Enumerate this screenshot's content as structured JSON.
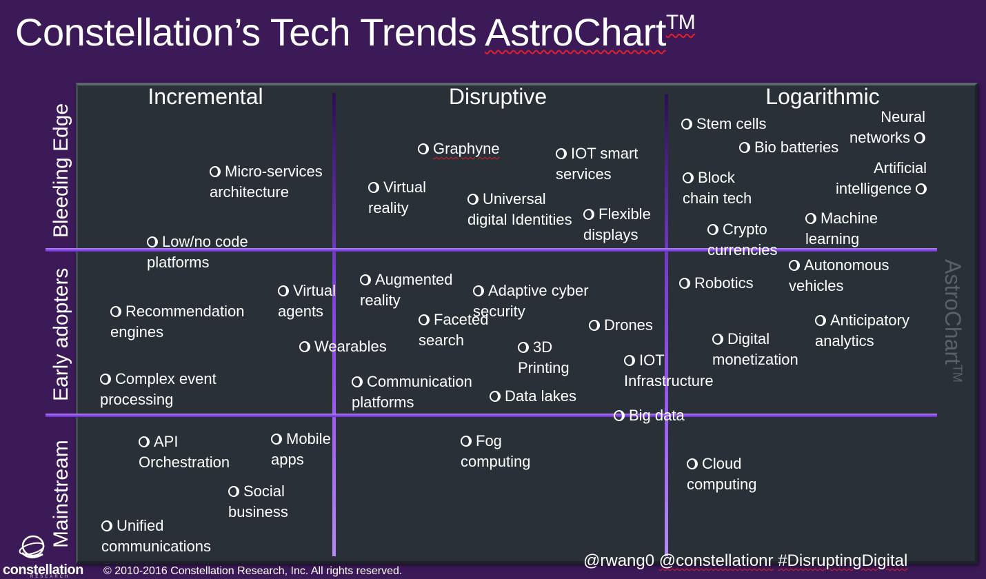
{
  "title": {
    "prefix": "Constellation’s Tech Trends ",
    "brand": "AstroChart",
    "trademark": "TM"
  },
  "columns": [
    "Incremental",
    "Disruptive",
    "Logarithmic"
  ],
  "rows": [
    "Bleeding Edge",
    "Early adopters",
    "Mainstream"
  ],
  "side_watermark": {
    "text": "AstroChart",
    "trademark": "TM"
  },
  "colors": {
    "background": "#3c1a58",
    "panel": "#293038",
    "grid_line": "#9d5cf2",
    "text": "#ffffff",
    "spellcheck_underline": "#e0202a"
  },
  "items": [
    {
      "label": "Micro-services\narchitecture",
      "column": "Incremental",
      "row": "Bleeding Edge"
    },
    {
      "label": "Low/no code\nplatforms",
      "column": "Incremental",
      "row": "Bleeding Edge"
    },
    {
      "label": "Graphyne",
      "column": "Disruptive",
      "row": "Bleeding Edge"
    },
    {
      "label": "IOT smart\nservices",
      "column": "Disruptive",
      "row": "Bleeding Edge"
    },
    {
      "label": "Virtual\nreality",
      "column": "Disruptive",
      "row": "Bleeding Edge"
    },
    {
      "label": "Universal\ndigital Identities",
      "column": "Disruptive",
      "row": "Bleeding Edge"
    },
    {
      "label": "Flexible\ndisplays",
      "column": "Disruptive",
      "row": "Bleeding Edge"
    },
    {
      "label": "Stem cells",
      "column": "Logarithmic",
      "row": "Bleeding Edge"
    },
    {
      "label": "Neural\nnetworks",
      "column": "Logarithmic",
      "row": "Bleeding Edge"
    },
    {
      "label": "Bio batteries",
      "column": "Logarithmic",
      "row": "Bleeding Edge"
    },
    {
      "label": "Block\nchain tech",
      "column": "Logarithmic",
      "row": "Bleeding Edge"
    },
    {
      "label": "Artificial\nintelligence",
      "column": "Logarithmic",
      "row": "Bleeding Edge"
    },
    {
      "label": "Crypto\ncurrencies",
      "column": "Logarithmic",
      "row": "Bleeding Edge"
    },
    {
      "label": "Machine\nlearning",
      "column": "Logarithmic",
      "row": "Bleeding Edge"
    },
    {
      "label": "Virtual\nagents",
      "column": "Incremental",
      "row": "Early adopters"
    },
    {
      "label": "Recommendation\nengines",
      "column": "Incremental",
      "row": "Early adopters"
    },
    {
      "label": "Wearables",
      "column": "Incremental",
      "row": "Early adopters"
    },
    {
      "label": "Complex event\nprocessing",
      "column": "Incremental",
      "row": "Early adopters"
    },
    {
      "label": "Augmented\nreality",
      "column": "Disruptive",
      "row": "Early adopters"
    },
    {
      "label": "Adaptive cyber\nsecurity",
      "column": "Disruptive",
      "row": "Early adopters"
    },
    {
      "label": "Faceted\nsearch",
      "column": "Disruptive",
      "row": "Early adopters"
    },
    {
      "label": "Drones",
      "column": "Disruptive",
      "row": "Early adopters"
    },
    {
      "label": "3D\nPrinting",
      "column": "Disruptive",
      "row": "Early adopters"
    },
    {
      "label": "IOT\nInfrastructure",
      "column": "Disruptive",
      "row": "Early adopters"
    },
    {
      "label": "Communication\nplatforms",
      "column": "Disruptive",
      "row": "Early adopters"
    },
    {
      "label": "Data lakes",
      "column": "Disruptive",
      "row": "Early adopters"
    },
    {
      "label": "Big data",
      "column": "Disruptive",
      "row": "Early adopters"
    },
    {
      "label": "Robotics",
      "column": "Logarithmic",
      "row": "Early adopters"
    },
    {
      "label": "Autonomous\nvehicles",
      "column": "Logarithmic",
      "row": "Early adopters"
    },
    {
      "label": "Anticipatory\nanalytics",
      "column": "Logarithmic",
      "row": "Early adopters"
    },
    {
      "label": "Digital\nmonetization",
      "column": "Logarithmic",
      "row": "Early adopters"
    },
    {
      "label": "API\nOrchestration",
      "column": "Incremental",
      "row": "Mainstream"
    },
    {
      "label": "Mobile\napps",
      "column": "Incremental",
      "row": "Mainstream"
    },
    {
      "label": "Social\nbusiness",
      "column": "Incremental",
      "row": "Mainstream"
    },
    {
      "label": "Unified\ncommunications",
      "column": "Incremental",
      "row": "Mainstream"
    },
    {
      "label": "Fog\ncomputing",
      "column": "Disruptive",
      "row": "Mainstream"
    },
    {
      "label": "Cloud\ncomputing",
      "column": "Logarithmic",
      "row": "Mainstream"
    }
  ],
  "footer": {
    "copyright": "© 2010-2016 Constellation Research, Inc. All rights reserved.",
    "handle_1": "@rwang0 ",
    "handle_2": "@constellationr",
    "hashtag": "#DisruptingDigital",
    "logo_text": "constellation",
    "logo_sub": "RESEARCH"
  }
}
